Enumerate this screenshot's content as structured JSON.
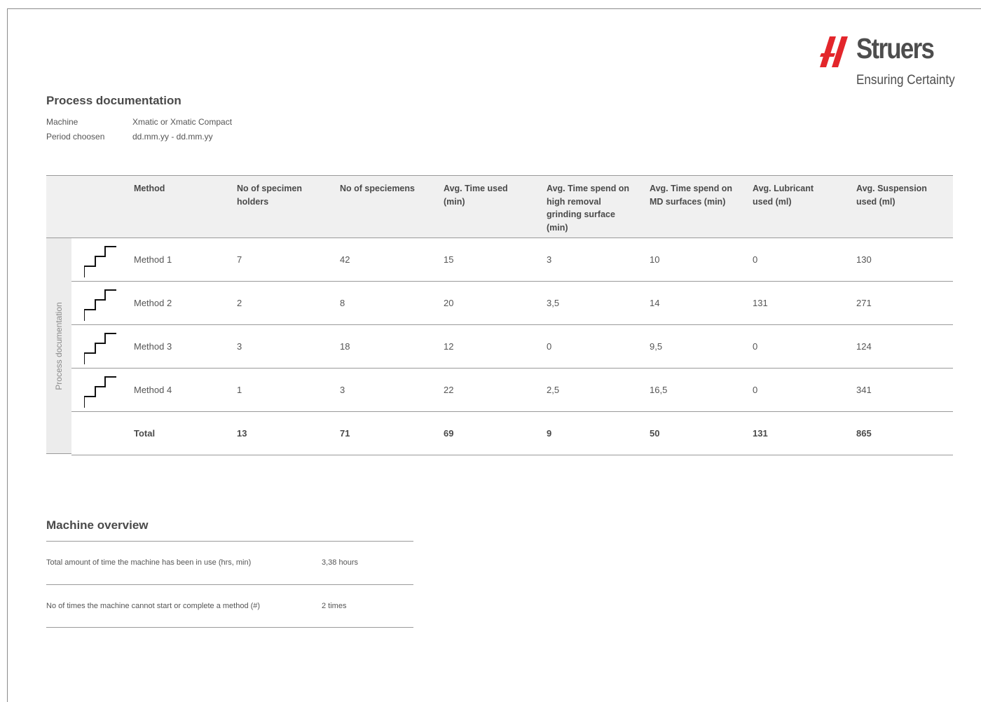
{
  "brand": {
    "name": "Struers",
    "tagline": "Ensuring Certainty",
    "accent_color": "#e3262b"
  },
  "process_documentation": {
    "title": "Process documentation",
    "machine_label": "Machine",
    "machine_value": "Xmatic or Xmatic Compact",
    "period_label": "Period choosen",
    "period_value": "dd.mm.yy - dd.mm.yy",
    "side_label": "Process documentation",
    "headers": [
      "Method",
      "No of specimen holders",
      "No of speciemens",
      "Avg. Time used (min)",
      "Avg. Time spend on high removal grinding surface (min)",
      "Avg. Time spend on MD surfaces (min)",
      "Avg. Lubricant used (ml)",
      "Avg. Suspension used (ml)"
    ],
    "rows": [
      {
        "icon": "stairs-icon",
        "cells": [
          "Method 1",
          "7",
          "42",
          "15",
          "3",
          "10",
          "0",
          "130"
        ]
      },
      {
        "icon": "stairs-icon",
        "cells": [
          "Method 2",
          "2",
          "8",
          "20",
          "3,5",
          "14",
          "131",
          "271"
        ]
      },
      {
        "icon": "stairs-icon",
        "cells": [
          "Method 3",
          "3",
          "18",
          "12",
          "0",
          "9,5",
          "0",
          "124"
        ]
      },
      {
        "icon": "stairs-icon",
        "cells": [
          "Method 4",
          "1",
          "3",
          "22",
          "2,5",
          "16,5",
          "0",
          "341"
        ]
      }
    ],
    "total": [
      "Total",
      "13",
      "71",
      "69",
      "9",
      "50",
      "131",
      "865"
    ]
  },
  "machine_overview": {
    "title": "Machine overview",
    "rows": [
      {
        "label": "Total amount of time the machine has been in use (hrs, min)",
        "value": "3,38 hours"
      },
      {
        "label": "No of times the machine cannot start or complete a method (#)",
        "value": "2 times"
      }
    ]
  }
}
